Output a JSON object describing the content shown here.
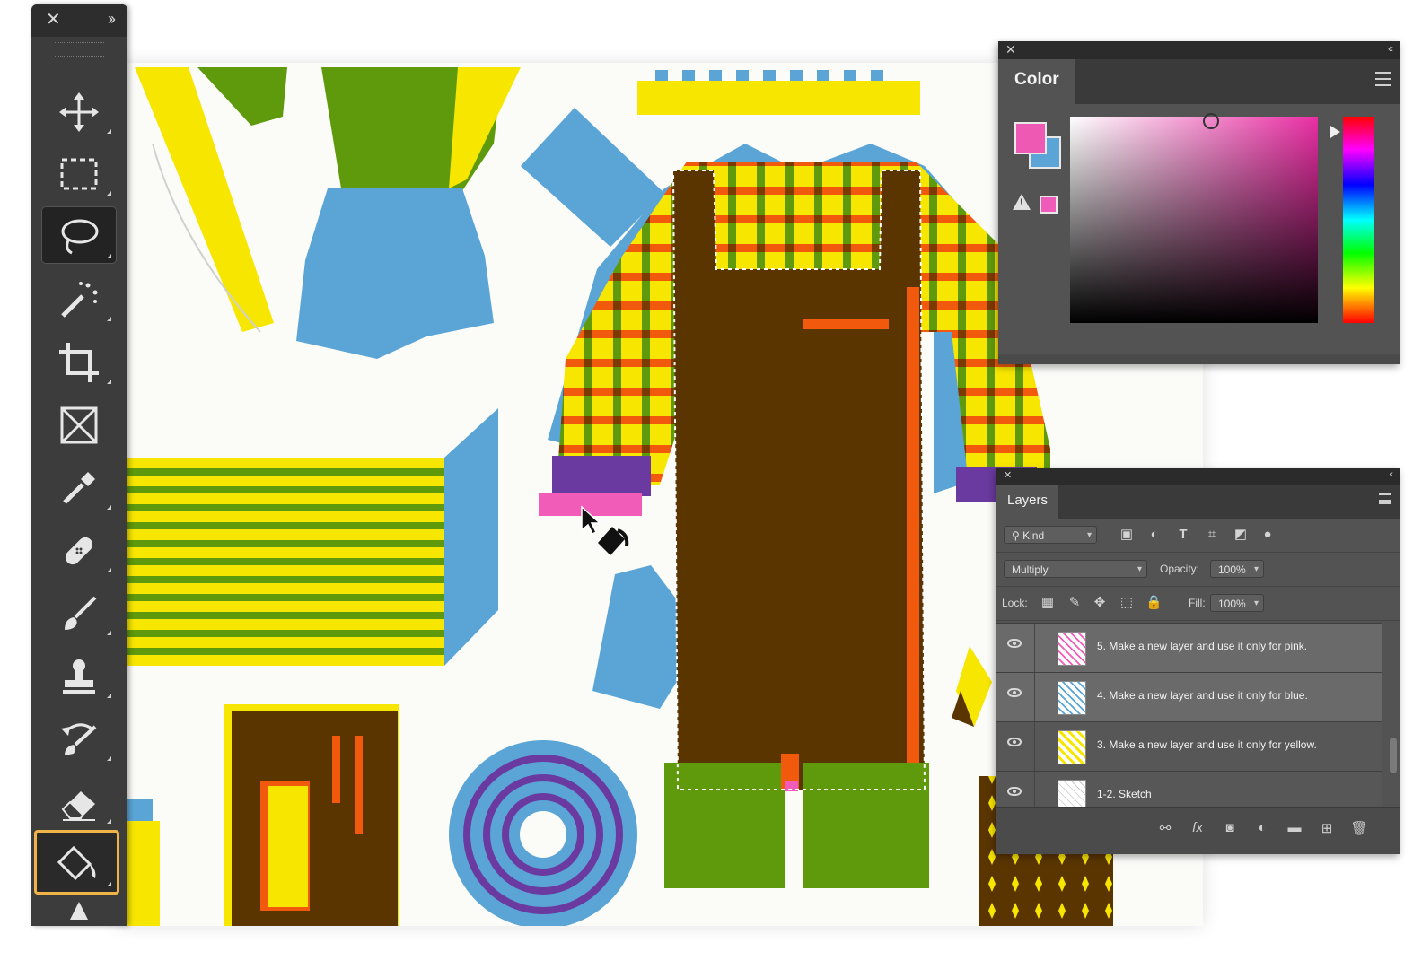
{
  "toolbar": {
    "close_icon": "close-icon",
    "expand_icon": "double-chevron-right-icon",
    "tools": [
      {
        "name": "move-tool",
        "icon": "move-arrows-icon"
      },
      {
        "name": "rectangular-marquee-tool",
        "icon": "dashed-rectangle-icon"
      },
      {
        "name": "lasso-tool",
        "icon": "lasso-icon",
        "active": true
      },
      {
        "name": "magic-wand-tool",
        "icon": "magic-wand-icon"
      },
      {
        "name": "crop-tool",
        "icon": "crop-icon"
      },
      {
        "name": "frame-tool",
        "icon": "frame-icon"
      },
      {
        "name": "eyedropper-tool",
        "icon": "eyedropper-icon"
      },
      {
        "name": "spot-healing-tool",
        "icon": "bandage-icon"
      },
      {
        "name": "brush-tool",
        "icon": "brush-icon"
      },
      {
        "name": "clone-stamp-tool",
        "icon": "stamp-icon"
      },
      {
        "name": "history-brush-tool",
        "icon": "history-brush-icon"
      },
      {
        "name": "eraser-tool",
        "icon": "eraser-icon"
      },
      {
        "name": "paint-bucket-tool",
        "icon": "paint-bucket-icon",
        "selected": true
      }
    ]
  },
  "color_panel": {
    "tab": "Color",
    "foreground": "#ee59b3",
    "background": "#5ba4d6",
    "hue_color": "#ea2fa4"
  },
  "layers_panel": {
    "tab": "Layers",
    "filter": {
      "label": "Kind"
    },
    "blend_mode": "Multiply",
    "opacity_label": "Opacity:",
    "opacity_value": "100%",
    "lock_label": "Lock:",
    "fill_label": "Fill:",
    "fill_value": "100%",
    "layers": [
      {
        "name": "5. Make a new layer and use it only for pink.",
        "highlighted": true
      },
      {
        "name": "4. Make a new layer and use it only for blue.",
        "highlighted": true
      },
      {
        "name": "3. Make a new layer and use it only for yellow.",
        "highlighted": false
      },
      {
        "name": "1-2. Sketch",
        "highlighted": false
      }
    ]
  },
  "colors": {
    "yellow": "#f7e600",
    "green": "#5f9a0c",
    "blue": "#5aa5d6",
    "brown": "#5a3500",
    "orange": "#f15a0d",
    "pink": "#f05cb8",
    "purple": "#6a3aa0"
  }
}
